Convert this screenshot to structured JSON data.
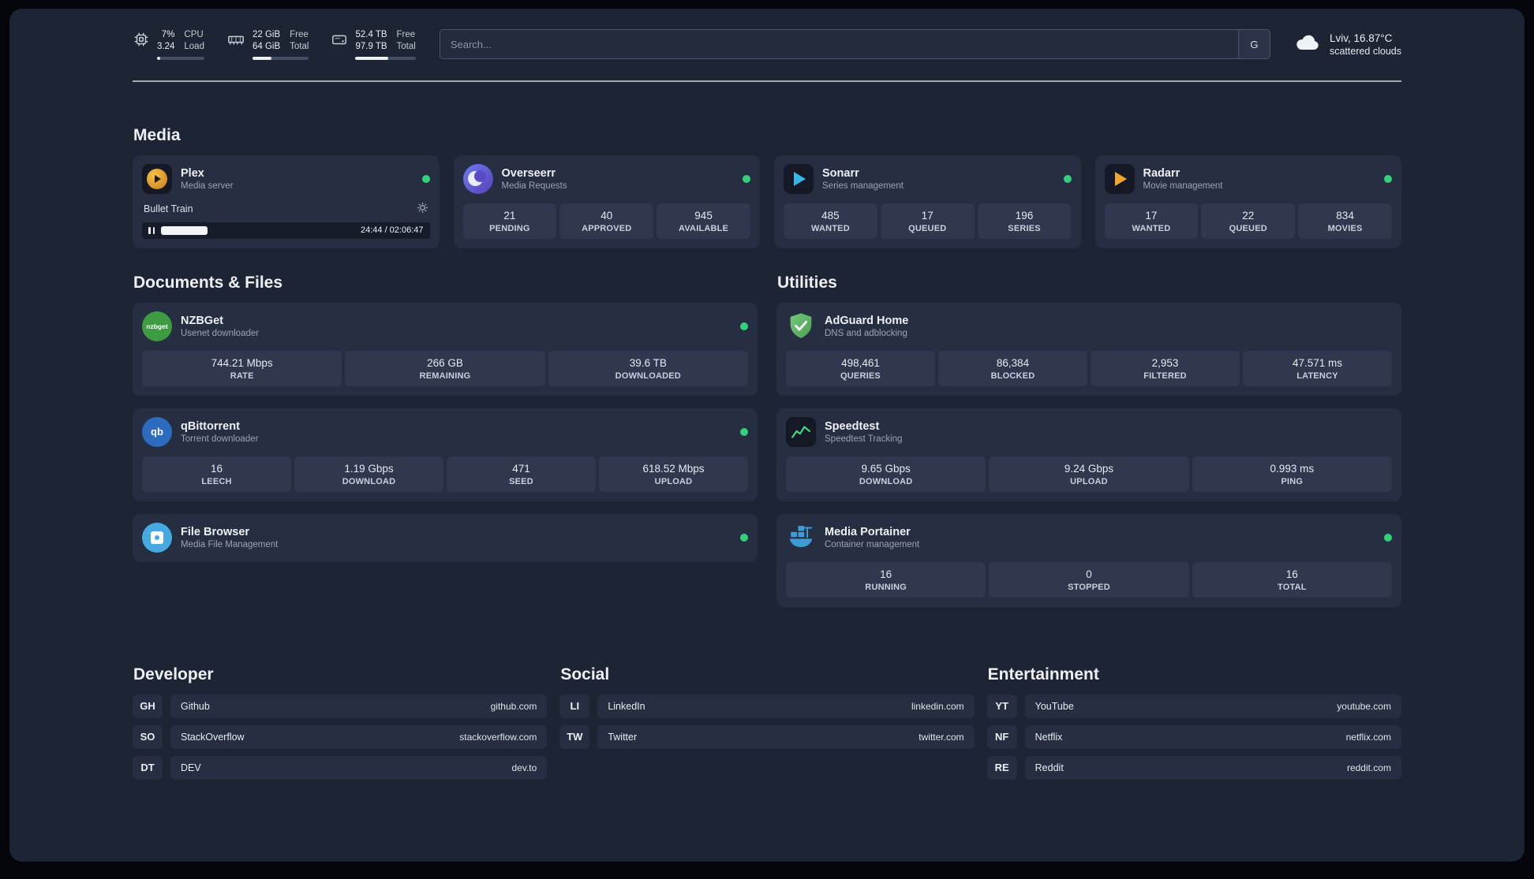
{
  "colors": {
    "status_online": "#33d17a",
    "accent_green": "#3ddc84"
  },
  "header": {
    "cpu": {
      "value_top": "7%",
      "value_bottom": "3.24",
      "label_top": "CPU",
      "label_bottom": "Load",
      "percent": 7
    },
    "ram": {
      "value_top": "22 GiB",
      "value_bottom": "64 GiB",
      "label_top": "Free",
      "label_bottom": "Total",
      "percent": 34
    },
    "disk": {
      "value_top": "52.4 TB",
      "value_bottom": "97.9 TB",
      "label_top": "Free",
      "label_bottom": "Total",
      "percent": 54
    },
    "search": {
      "placeholder": "Search...",
      "button_label": "G"
    },
    "weather": {
      "location": "Lviv, 16.87°C",
      "condition": "scattered clouds",
      "icon": "cloud-icon"
    }
  },
  "sections": {
    "media": {
      "title": "Media",
      "plex": {
        "name": "Plex",
        "subtitle": "Media server",
        "icon": "plex-icon",
        "status": "online",
        "now_playing": "Bullet Train",
        "time": "24:44 / 02:06:47",
        "progress_percent": 17
      },
      "overseerr": {
        "name": "Overseerr",
        "subtitle": "Media Requests",
        "icon": "overseerr-icon",
        "status": "online",
        "stats": [
          {
            "value": "21",
            "label": "PENDING"
          },
          {
            "value": "40",
            "label": "APPROVED"
          },
          {
            "value": "945",
            "label": "AVAILABLE"
          }
        ]
      },
      "sonarr": {
        "name": "Sonarr",
        "subtitle": "Series management",
        "icon": "sonarr-icon",
        "status": "online",
        "stats": [
          {
            "value": "485",
            "label": "WANTED"
          },
          {
            "value": "17",
            "label": "QUEUED"
          },
          {
            "value": "196",
            "label": "SERIES"
          }
        ]
      },
      "radarr": {
        "name": "Radarr",
        "subtitle": "Movie management",
        "icon": "radarr-icon",
        "status": "online",
        "stats": [
          {
            "value": "17",
            "label": "WANTED"
          },
          {
            "value": "22",
            "label": "QUEUED"
          },
          {
            "value": "834",
            "label": "MOVIES"
          }
        ]
      }
    },
    "documents": {
      "title": "Documents & Files",
      "nzbget": {
        "name": "NZBGet",
        "subtitle": "Usenet downloader",
        "icon": "nzbget-icon",
        "icon_label": "nzbget",
        "status": "online",
        "stats": [
          {
            "value": "744.21 Mbps",
            "label": "RATE"
          },
          {
            "value": "266 GB",
            "label": "REMAINING"
          },
          {
            "value": "39.6 TB",
            "label": "DOWNLOADED"
          }
        ]
      },
      "qbittorrent": {
        "name": "qBittorrent",
        "subtitle": "Torrent downloader",
        "icon": "qbittorrent-icon",
        "icon_label": "qb",
        "status": "online",
        "stats": [
          {
            "value": "16",
            "label": "LEECH"
          },
          {
            "value": "1.19 Gbps",
            "label": "DOWNLOAD"
          },
          {
            "value": "471",
            "label": "SEED"
          },
          {
            "value": "618.52 Mbps",
            "label": "UPLOAD"
          }
        ]
      },
      "filebrowser": {
        "name": "File Browser",
        "subtitle": "Media File Management",
        "icon": "filebrowser-icon",
        "status": "online"
      }
    },
    "utilities": {
      "title": "Utilities",
      "adguard": {
        "name": "AdGuard Home",
        "subtitle": "DNS and adblocking",
        "icon": "adguard-shield-icon",
        "stats": [
          {
            "value": "498,461",
            "label": "QUERIES"
          },
          {
            "value": "86,384",
            "label": "BLOCKED"
          },
          {
            "value": "2,953",
            "label": "FILTERED"
          },
          {
            "value": "47.571 ms",
            "label": "LATENCY"
          }
        ]
      },
      "speedtest": {
        "name": "Speedtest",
        "subtitle": "Speedtest Tracking",
        "icon": "speedtest-graph-icon",
        "stats": [
          {
            "value": "9.65 Gbps",
            "label": "DOWNLOAD"
          },
          {
            "value": "9.24 Gbps",
            "label": "UPLOAD"
          },
          {
            "value": "0.993 ms",
            "label": "PING"
          }
        ]
      },
      "portainer": {
        "name": "Media Portainer",
        "subtitle": "Container management",
        "icon": "portainer-icon",
        "status": "online",
        "stats": [
          {
            "value": "16",
            "label": "RUNNING"
          },
          {
            "value": "0",
            "label": "STOPPED"
          },
          {
            "value": "16",
            "label": "TOTAL"
          }
        ]
      }
    },
    "bookmarks": {
      "developer": {
        "title": "Developer",
        "items": [
          {
            "abbr": "GH",
            "name": "Github",
            "url": "github.com"
          },
          {
            "abbr": "SO",
            "name": "StackOverflow",
            "url": "stackoverflow.com"
          },
          {
            "abbr": "DT",
            "name": "DEV",
            "url": "dev.to"
          }
        ]
      },
      "social": {
        "title": "Social",
        "items": [
          {
            "abbr": "LI",
            "name": "LinkedIn",
            "url": "linkedin.com"
          },
          {
            "abbr": "TW",
            "name": "Twitter",
            "url": "twitter.com"
          }
        ]
      },
      "entertainment": {
        "title": "Entertainment",
        "items": [
          {
            "abbr": "YT",
            "name": "YouTube",
            "url": "youtube.com"
          },
          {
            "abbr": "NF",
            "name": "Netflix",
            "url": "netflix.com"
          },
          {
            "abbr": "RE",
            "name": "Reddit",
            "url": "reddit.com"
          }
        ]
      }
    }
  }
}
